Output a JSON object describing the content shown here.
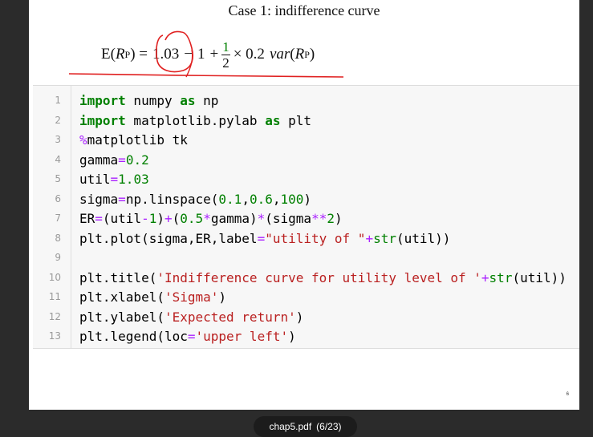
{
  "slide": {
    "title": "Case 1: indifference curve",
    "formula": {
      "lhs_E": "E(",
      "lhs_R": "R",
      "lhs_sub": "P",
      "lhs_close": ") =",
      "util": "1.03",
      "minus": "−",
      "one": "1",
      "plus": "+",
      "frac_num": "1",
      "frac_den": "2",
      "times": "× 0.2",
      "var": "var",
      "var_open": "(",
      "var_R": "R",
      "var_sub": "P",
      "var_close": ")"
    },
    "annotation_color": "#e02020"
  },
  "code": {
    "line_numbers": [
      "1",
      "2",
      "3",
      "4",
      "5",
      "6",
      "7",
      "8",
      "9",
      "10",
      "11",
      "12",
      "13"
    ],
    "lines": [
      [
        {
          "t": "kw",
          "v": "import"
        },
        {
          "t": "",
          "v": " numpy "
        },
        {
          "t": "kw",
          "v": "as"
        },
        {
          "t": "",
          "v": " np"
        }
      ],
      [
        {
          "t": "kw",
          "v": "import"
        },
        {
          "t": "",
          "v": " matplotlib.pylab "
        },
        {
          "t": "kw",
          "v": "as"
        },
        {
          "t": "",
          "v": " plt"
        }
      ],
      [
        {
          "t": "op",
          "v": "%"
        },
        {
          "t": "",
          "v": "matplotlib tk"
        }
      ],
      [
        {
          "t": "",
          "v": "gamma"
        },
        {
          "t": "op",
          "v": "="
        },
        {
          "t": "num",
          "v": "0.2"
        }
      ],
      [
        {
          "t": "",
          "v": "util"
        },
        {
          "t": "op",
          "v": "="
        },
        {
          "t": "num",
          "v": "1.03"
        }
      ],
      [
        {
          "t": "",
          "v": "sigma"
        },
        {
          "t": "op",
          "v": "="
        },
        {
          "t": "",
          "v": "np.linspace("
        },
        {
          "t": "num",
          "v": "0.1"
        },
        {
          "t": "",
          "v": ","
        },
        {
          "t": "num",
          "v": "0.6"
        },
        {
          "t": "",
          "v": ","
        },
        {
          "t": "num",
          "v": "100"
        },
        {
          "t": "",
          "v": ")"
        }
      ],
      [
        {
          "t": "",
          "v": "ER"
        },
        {
          "t": "op",
          "v": "="
        },
        {
          "t": "",
          "v": "(util"
        },
        {
          "t": "op",
          "v": "-"
        },
        {
          "t": "num",
          "v": "1"
        },
        {
          "t": "",
          "v": ")"
        },
        {
          "t": "op",
          "v": "+"
        },
        {
          "t": "",
          "v": "("
        },
        {
          "t": "num",
          "v": "0.5"
        },
        {
          "t": "op",
          "v": "*"
        },
        {
          "t": "",
          "v": "gamma)"
        },
        {
          "t": "op",
          "v": "*"
        },
        {
          "t": "",
          "v": "(sigma"
        },
        {
          "t": "op",
          "v": "**"
        },
        {
          "t": "num",
          "v": "2"
        },
        {
          "t": "",
          "v": ")"
        }
      ],
      [
        {
          "t": "",
          "v": "plt.plot(sigma,ER,label"
        },
        {
          "t": "op",
          "v": "="
        },
        {
          "t": "str",
          "v": "\"utility of \""
        },
        {
          "t": "op",
          "v": "+"
        },
        {
          "t": "bi",
          "v": "str"
        },
        {
          "t": "",
          "v": "(util))"
        }
      ],
      [],
      [
        {
          "t": "",
          "v": "plt.title("
        },
        {
          "t": "str",
          "v": "'Indifference curve for utility level of '"
        },
        {
          "t": "op",
          "v": "+"
        },
        {
          "t": "bi",
          "v": "str"
        },
        {
          "t": "",
          "v": "(util))"
        }
      ],
      [
        {
          "t": "",
          "v": "plt.xlabel("
        },
        {
          "t": "str",
          "v": "'Sigma'"
        },
        {
          "t": "",
          "v": ")"
        }
      ],
      [
        {
          "t": "",
          "v": "plt.ylabel("
        },
        {
          "t": "str",
          "v": "'Expected return'"
        },
        {
          "t": "",
          "v": ")"
        }
      ],
      [
        {
          "t": "",
          "v": "plt.legend(loc"
        },
        {
          "t": "op",
          "v": "="
        },
        {
          "t": "str",
          "v": "'upper left'"
        },
        {
          "t": "",
          "v": ")"
        }
      ]
    ]
  },
  "corner_mark": "6",
  "viewer": {
    "filename": "chap5.pdf",
    "page_indicator": "(6/23)"
  }
}
